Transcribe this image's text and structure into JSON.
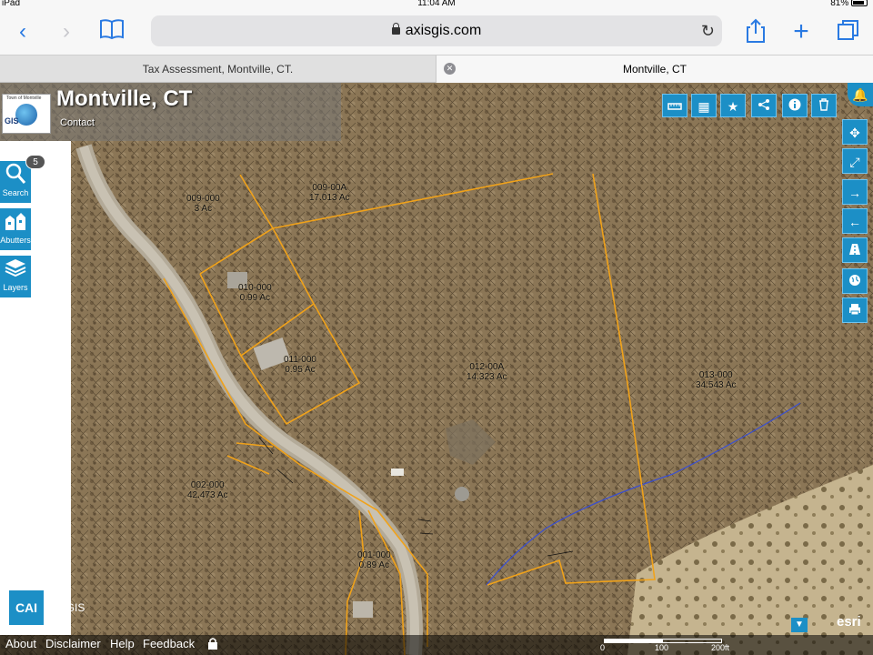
{
  "status_bar": {
    "device": "iPad",
    "time": "11:04 AM",
    "battery": "81%"
  },
  "browser": {
    "url": "axisgis.com",
    "tabs": [
      {
        "label": "Tax Assessment, Montville, CT."
      },
      {
        "label": "Montville, CT"
      }
    ]
  },
  "app": {
    "title": "Montville, CT",
    "contact": "Contact",
    "logo_text": "GIS",
    "logo_caption": "Town of Montville"
  },
  "sidebar": {
    "badge": "5",
    "items": [
      {
        "label": "Search",
        "icon": "magnifier-icon"
      },
      {
        "label": "Abutters",
        "icon": "buildings-icon"
      },
      {
        "label": "Layers",
        "icon": "layers-icon"
      }
    ]
  },
  "toolbar_icons": [
    "measure-icon",
    "grid-icon",
    "star-icon",
    "share-icon",
    "info-icon",
    "trash-icon"
  ],
  "nav_icons": [
    "pan-icon",
    "full-extent-icon",
    "forward-icon",
    "back-icon",
    "road-icon",
    "globe-icon",
    "print-icon"
  ],
  "parcels": [
    {
      "id": "009-000",
      "area": "3 Ac"
    },
    {
      "id": "009-00A",
      "area": "17.013 Ac"
    },
    {
      "id": "010-000",
      "area": "0.99 Ac"
    },
    {
      "id": "011-000",
      "area": "0.95 Ac"
    },
    {
      "id": "012-00A",
      "area": "14.323 Ac"
    },
    {
      "id": "013-000",
      "area": "34.543 Ac"
    },
    {
      "id": "002-000",
      "area": "42.473 Ac"
    },
    {
      "id": "001-000",
      "area": "0.89 Ac"
    }
  ],
  "footer": {
    "links": [
      "About",
      "Disclaimer",
      "Help",
      "Feedback"
    ],
    "scale": [
      "0",
      "100",
      "200ft"
    ],
    "brand": "CAI",
    "brand_suffix": "AxisGIS",
    "esri": "esri"
  },
  "colors": {
    "accent": "#1c8fc6",
    "parcel_line": "#f0a21a",
    "stream": "#3a4fd0"
  }
}
